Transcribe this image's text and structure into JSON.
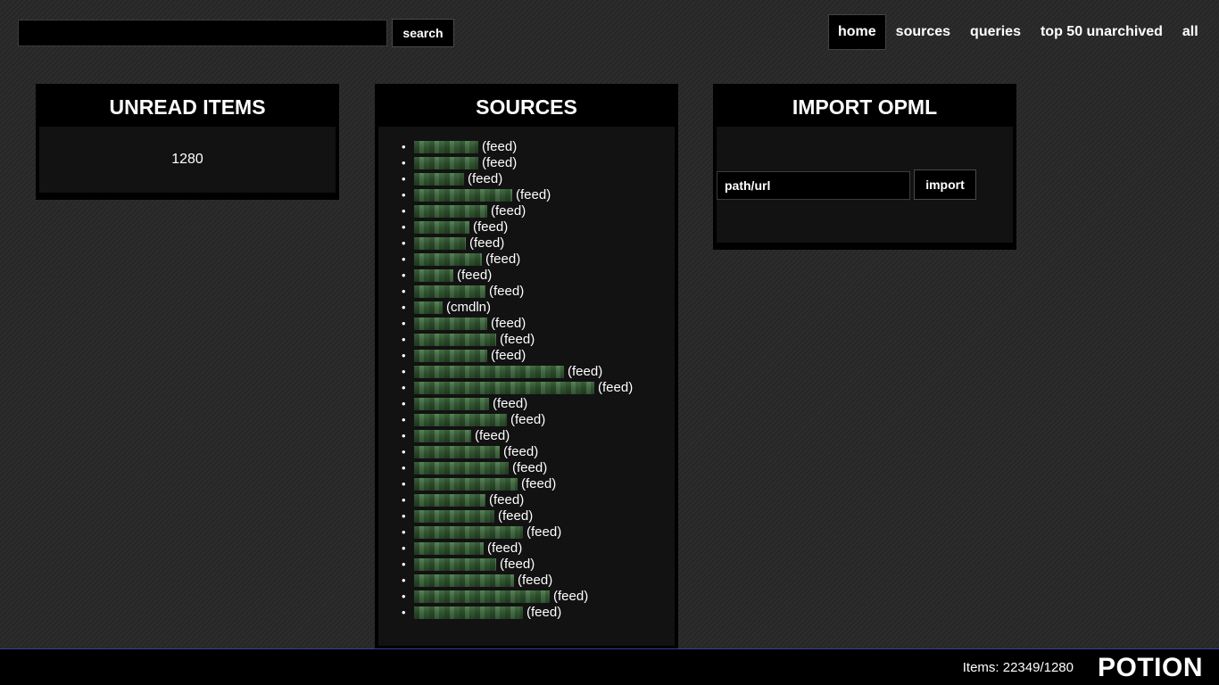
{
  "search": {
    "value": "",
    "placeholder": "",
    "button_label": "search"
  },
  "nav": {
    "items": [
      {
        "label": "home",
        "active": true
      },
      {
        "label": "sources",
        "active": false
      },
      {
        "label": "queries",
        "active": false
      },
      {
        "label": "top 50 unarchived",
        "active": false
      },
      {
        "label": "all",
        "active": false
      }
    ]
  },
  "unread": {
    "title": "UNREAD ITEMS",
    "count": "1280"
  },
  "sources": {
    "title": "SOURCES",
    "items": [
      {
        "type": "(feed)"
      },
      {
        "type": "(feed)"
      },
      {
        "type": "(feed)"
      },
      {
        "type": "(feed)"
      },
      {
        "type": "(feed)"
      },
      {
        "type": "(feed)"
      },
      {
        "type": "(feed)"
      },
      {
        "type": "(feed)"
      },
      {
        "type": "(feed)"
      },
      {
        "type": "(feed)"
      },
      {
        "type": "(cmdln)"
      },
      {
        "type": "(feed)"
      },
      {
        "type": "(feed)"
      },
      {
        "type": "(feed)"
      },
      {
        "type": "(feed)"
      },
      {
        "type": "(feed)"
      },
      {
        "type": "(feed)"
      },
      {
        "type": "(feed)"
      },
      {
        "type": "(feed)"
      },
      {
        "type": "(feed)"
      },
      {
        "type": "(feed)"
      },
      {
        "type": "(feed)"
      },
      {
        "type": "(feed)"
      },
      {
        "type": "(feed)"
      },
      {
        "type": "(feed)"
      },
      {
        "type": "(feed)"
      },
      {
        "type": "(feed)"
      },
      {
        "type": "(feed)"
      },
      {
        "type": "(feed)"
      },
      {
        "type": "(feed)"
      }
    ]
  },
  "import_opml": {
    "title": "IMPORT OPML",
    "input_placeholder": "path/url",
    "button_label": "import"
  },
  "footer": {
    "items_text": "Items: 22349/1280",
    "brand": "POTION"
  }
}
